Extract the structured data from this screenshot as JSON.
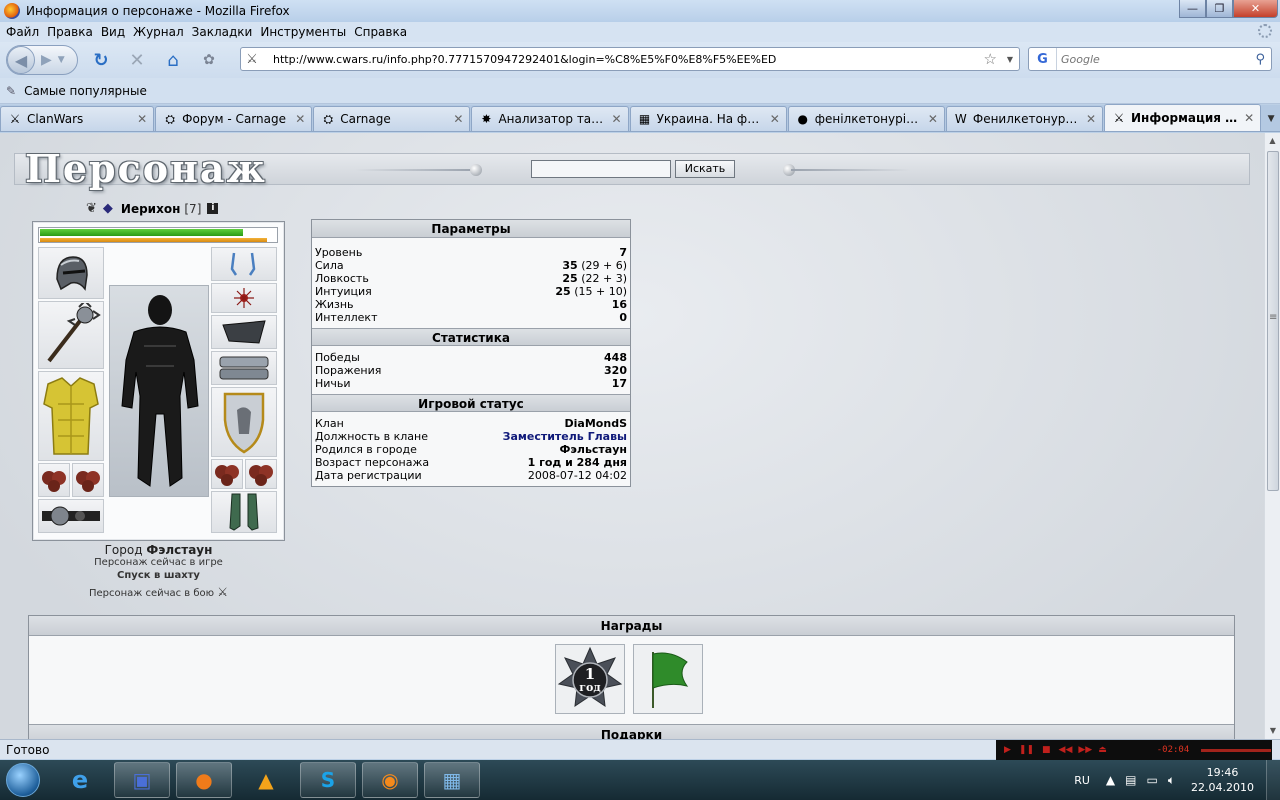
{
  "window": {
    "title": "Информация о персонаже - Mozilla Firefox",
    "min": "—",
    "max": "❐",
    "close": "✕"
  },
  "menu": [
    "Файл",
    "Правка",
    "Вид",
    "Журнал",
    "Закладки",
    "Инструменты",
    "Справка"
  ],
  "nav": {
    "url": "http://www.cwars.ru/info.php?0.7771570947292401&login=%C8%E5%F0%E8%F5%EE%ED",
    "search_placeholder": "Google"
  },
  "bookmarks": {
    "most_visited": "Самые популярные"
  },
  "tabs": [
    {
      "label": "ClanWars",
      "icon": "⚔",
      "width": 155,
      "active": false
    },
    {
      "label": "Форум - Carnage",
      "icon": "⛭",
      "width": 155,
      "active": false
    },
    {
      "label": "Carnage",
      "icon": "⛭",
      "width": 155,
      "active": false
    },
    {
      "label": "Анализатор такт...",
      "icon": "✸",
      "width": 155,
      "active": false
    },
    {
      "label": "Украина. На фин...",
      "icon": "▦",
      "width": 155,
      "active": false
    },
    {
      "label": "фенілкетонурія - ...",
      "icon": "●",
      "width": 155,
      "active": false
    },
    {
      "label": "Фенилкетонурия ...",
      "icon": "W",
      "width": 155,
      "active": false
    },
    {
      "label": "Информация о ...",
      "icon": "⚔",
      "width": 155,
      "active": true
    }
  ],
  "page": {
    "logo": "Персонаж",
    "search_button": "Искать"
  },
  "character": {
    "name": "Иерихон",
    "level": "[7]",
    "hp_fraction": 0.86,
    "mp_fraction": 0.96,
    "city_label": "Город",
    "city": "Фэлстаун",
    "status_line": "Персонаж сейчас в игре",
    "location": "Спуск в шахту",
    "battle_line": "Персонаж сейчас в бою"
  },
  "params": {
    "title": "Параметры",
    "rows": [
      {
        "label": "Уровень",
        "value": "7",
        "extra": ""
      },
      {
        "label": "Сила",
        "value": "35",
        "extra": " (29 + 6)"
      },
      {
        "label": "Ловкость",
        "value": "25",
        "extra": " (22 + 3)"
      },
      {
        "label": "Интуиция",
        "value": "25",
        "extra": " (15 + 10)"
      },
      {
        "label": "Жизнь",
        "value": "16",
        "extra": ""
      },
      {
        "label": "Интеллект",
        "value": "0",
        "extra": ""
      }
    ]
  },
  "stats": {
    "title": "Статистика",
    "rows": [
      {
        "label": "Победы",
        "value": "448"
      },
      {
        "label": "Поражения",
        "value": "320"
      },
      {
        "label": "Ничьи",
        "value": "17"
      }
    ]
  },
  "status": {
    "title": "Игровой статус",
    "rows": [
      {
        "label": "Клан",
        "value": "DiaMondS",
        "style": "bold"
      },
      {
        "label": "Должность в клане",
        "value": "Заместитель Главы",
        "style": "link"
      },
      {
        "label": "Родился в городе",
        "value": "Фэльстаун",
        "style": "bold"
      },
      {
        "label": "Возраст персонажа",
        "value": "1 год и 284 дня",
        "style": "bold"
      },
      {
        "label": "Дата регистрации",
        "value": "2008-07-12 04:02",
        "style": "plain"
      }
    ]
  },
  "awards": {
    "title": "Награды",
    "badge_number": "1",
    "badge_text": "год",
    "gifts_title": "Подарки"
  },
  "statusbar": {
    "text": "Готово",
    "player_time": "-02:04"
  },
  "taskbar": {
    "lang": "RU",
    "time": "19:46",
    "date": "22.04.2010"
  },
  "colors": {
    "link": "#101a7a",
    "hp": "#3db824",
    "mp": "#e59a1a"
  }
}
